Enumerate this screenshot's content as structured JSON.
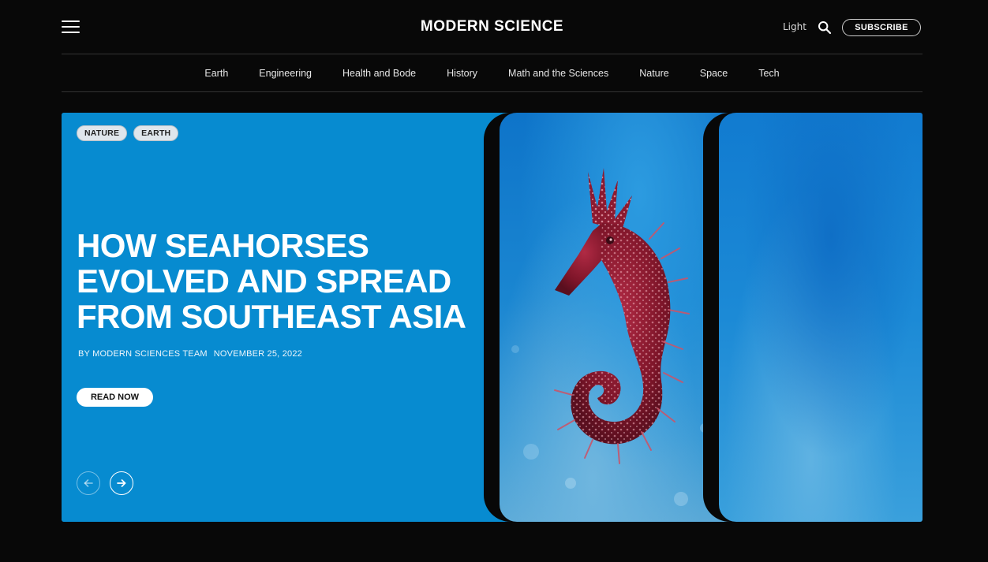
{
  "header": {
    "brand": "MODERN SCIENCE",
    "theme_label": "Light",
    "subscribe_label": "SUBSCRIBE"
  },
  "nav": {
    "items": [
      "Earth",
      "Engineering",
      "Health and Bode",
      "History",
      "Math and the Sciences",
      "Nature",
      "Space",
      "Tech"
    ]
  },
  "hero": {
    "tags": [
      "NATURE",
      "EARTH"
    ],
    "headline_lines": [
      "HOW SEAHORSES",
      "EVOLVED AND SPREAD",
      "FROM SOUTHEAST ASIA"
    ],
    "author": "BY MODERN SCIENCES TEAM",
    "date": "NOVEMBER 25, 2022",
    "cta_label": "READ NOW"
  },
  "icons": {
    "menu": "hamburger-menu-icon",
    "search": "search-icon",
    "prev": "arrow-left-circle-icon",
    "next": "arrow-right-circle-icon"
  },
  "colors": {
    "page_bg": "#080808",
    "hero_blue": "#078bd0",
    "seahorse": "#9b1c35"
  }
}
